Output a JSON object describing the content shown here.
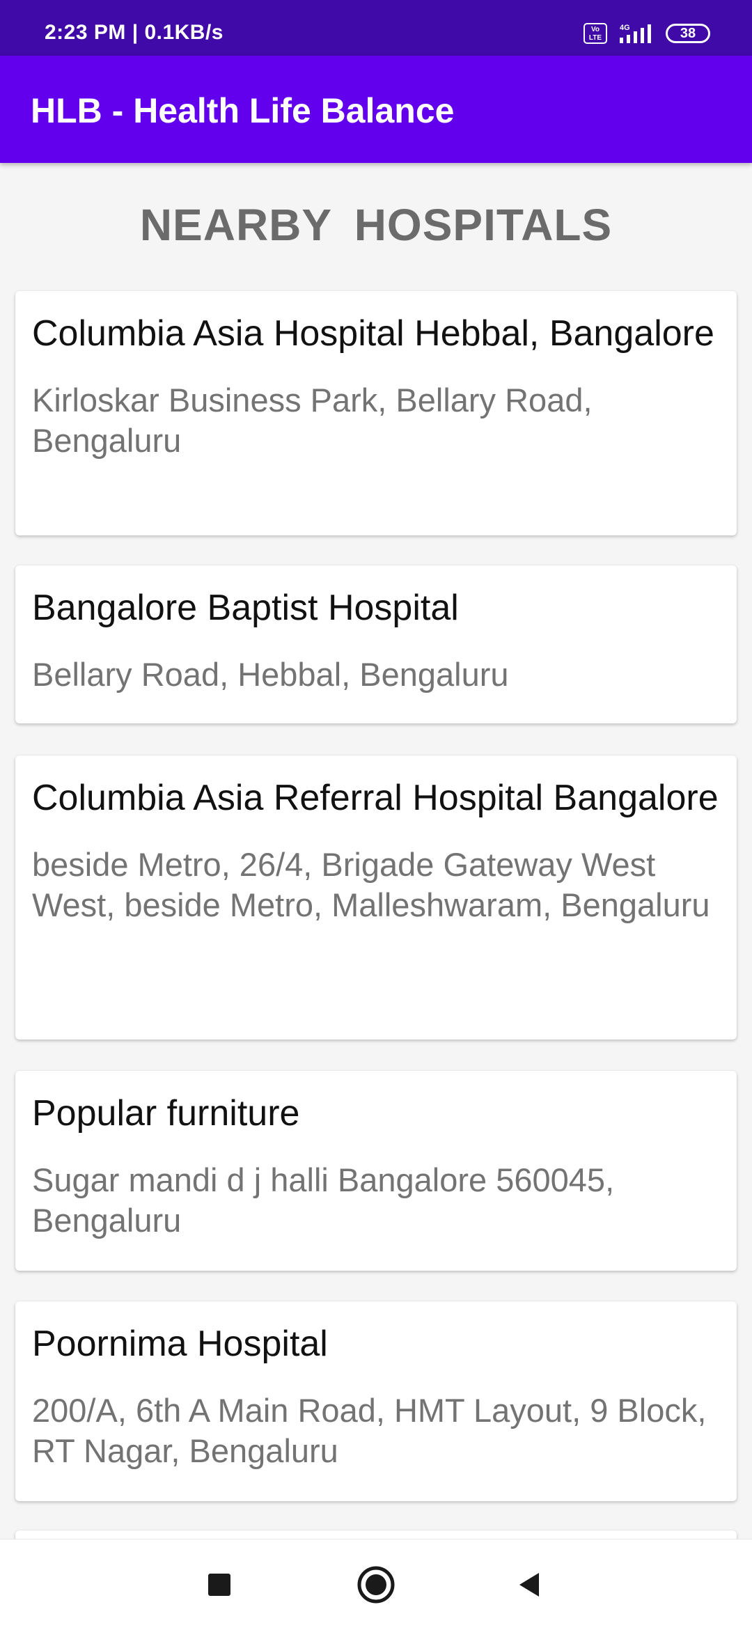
{
  "status_bar": {
    "time": "2:23 PM | 0.1KB/s",
    "volte_label": "Vo LTE",
    "network_label": "4G",
    "battery": "38",
    "icons": [
      "volte-icon",
      "signal-icon",
      "battery-icon"
    ]
  },
  "app_bar": {
    "title": "HLB - Health Life Balance",
    "color": "#6200ee"
  },
  "main": {
    "heading": "NEARBY  HOSPITALS",
    "hospitals": [
      {
        "name": "Columbia Asia Hospital Hebbal, Bangalore",
        "address": "Kirloskar Business Park, Bellary Road, Bengaluru"
      },
      {
        "name": "Bangalore Baptist Hospital",
        "address": "Bellary Road, Hebbal, Bengaluru"
      },
      {
        "name": "Columbia Asia Referral Hospital Bangalore",
        "address": "beside Metro, 26/4, Brigade Gateway West West, beside Metro, Malleshwaram, Bengaluru"
      },
      {
        "name": "Popular furniture",
        "address": "Sugar mandi d j halli Bangalore 560045, Bengaluru"
      },
      {
        "name": "Poornima Hospital",
        "address": "200/A, 6th A Main Road, HMT Layout, 9 Block, RT Nagar, Bengaluru"
      }
    ]
  },
  "nav_bar": {
    "icons": [
      "recents-square-icon",
      "home-circle-icon",
      "back-triangle-icon"
    ]
  }
}
